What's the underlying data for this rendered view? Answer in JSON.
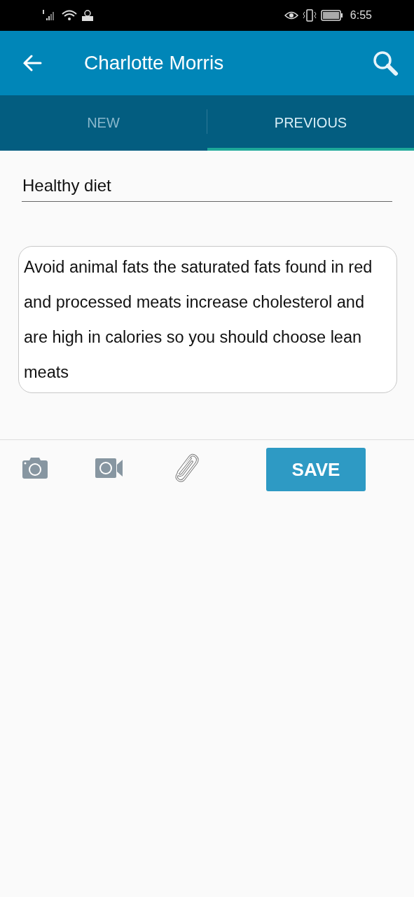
{
  "status_bar": {
    "time": "6:55"
  },
  "app_bar": {
    "title": "Charlotte Morris"
  },
  "tabs": [
    {
      "label": "NEW",
      "selected": false
    },
    {
      "label": "PREVIOUS",
      "selected": true
    }
  ],
  "title_field": {
    "value": "Healthy diet"
  },
  "note_field": {
    "value": "Avoid animal fats the saturated fats found in red and processed meats increase cholesterol and are high in calories so you should choose lean meats"
  },
  "toolbar": {
    "save_button": "SAVE"
  }
}
